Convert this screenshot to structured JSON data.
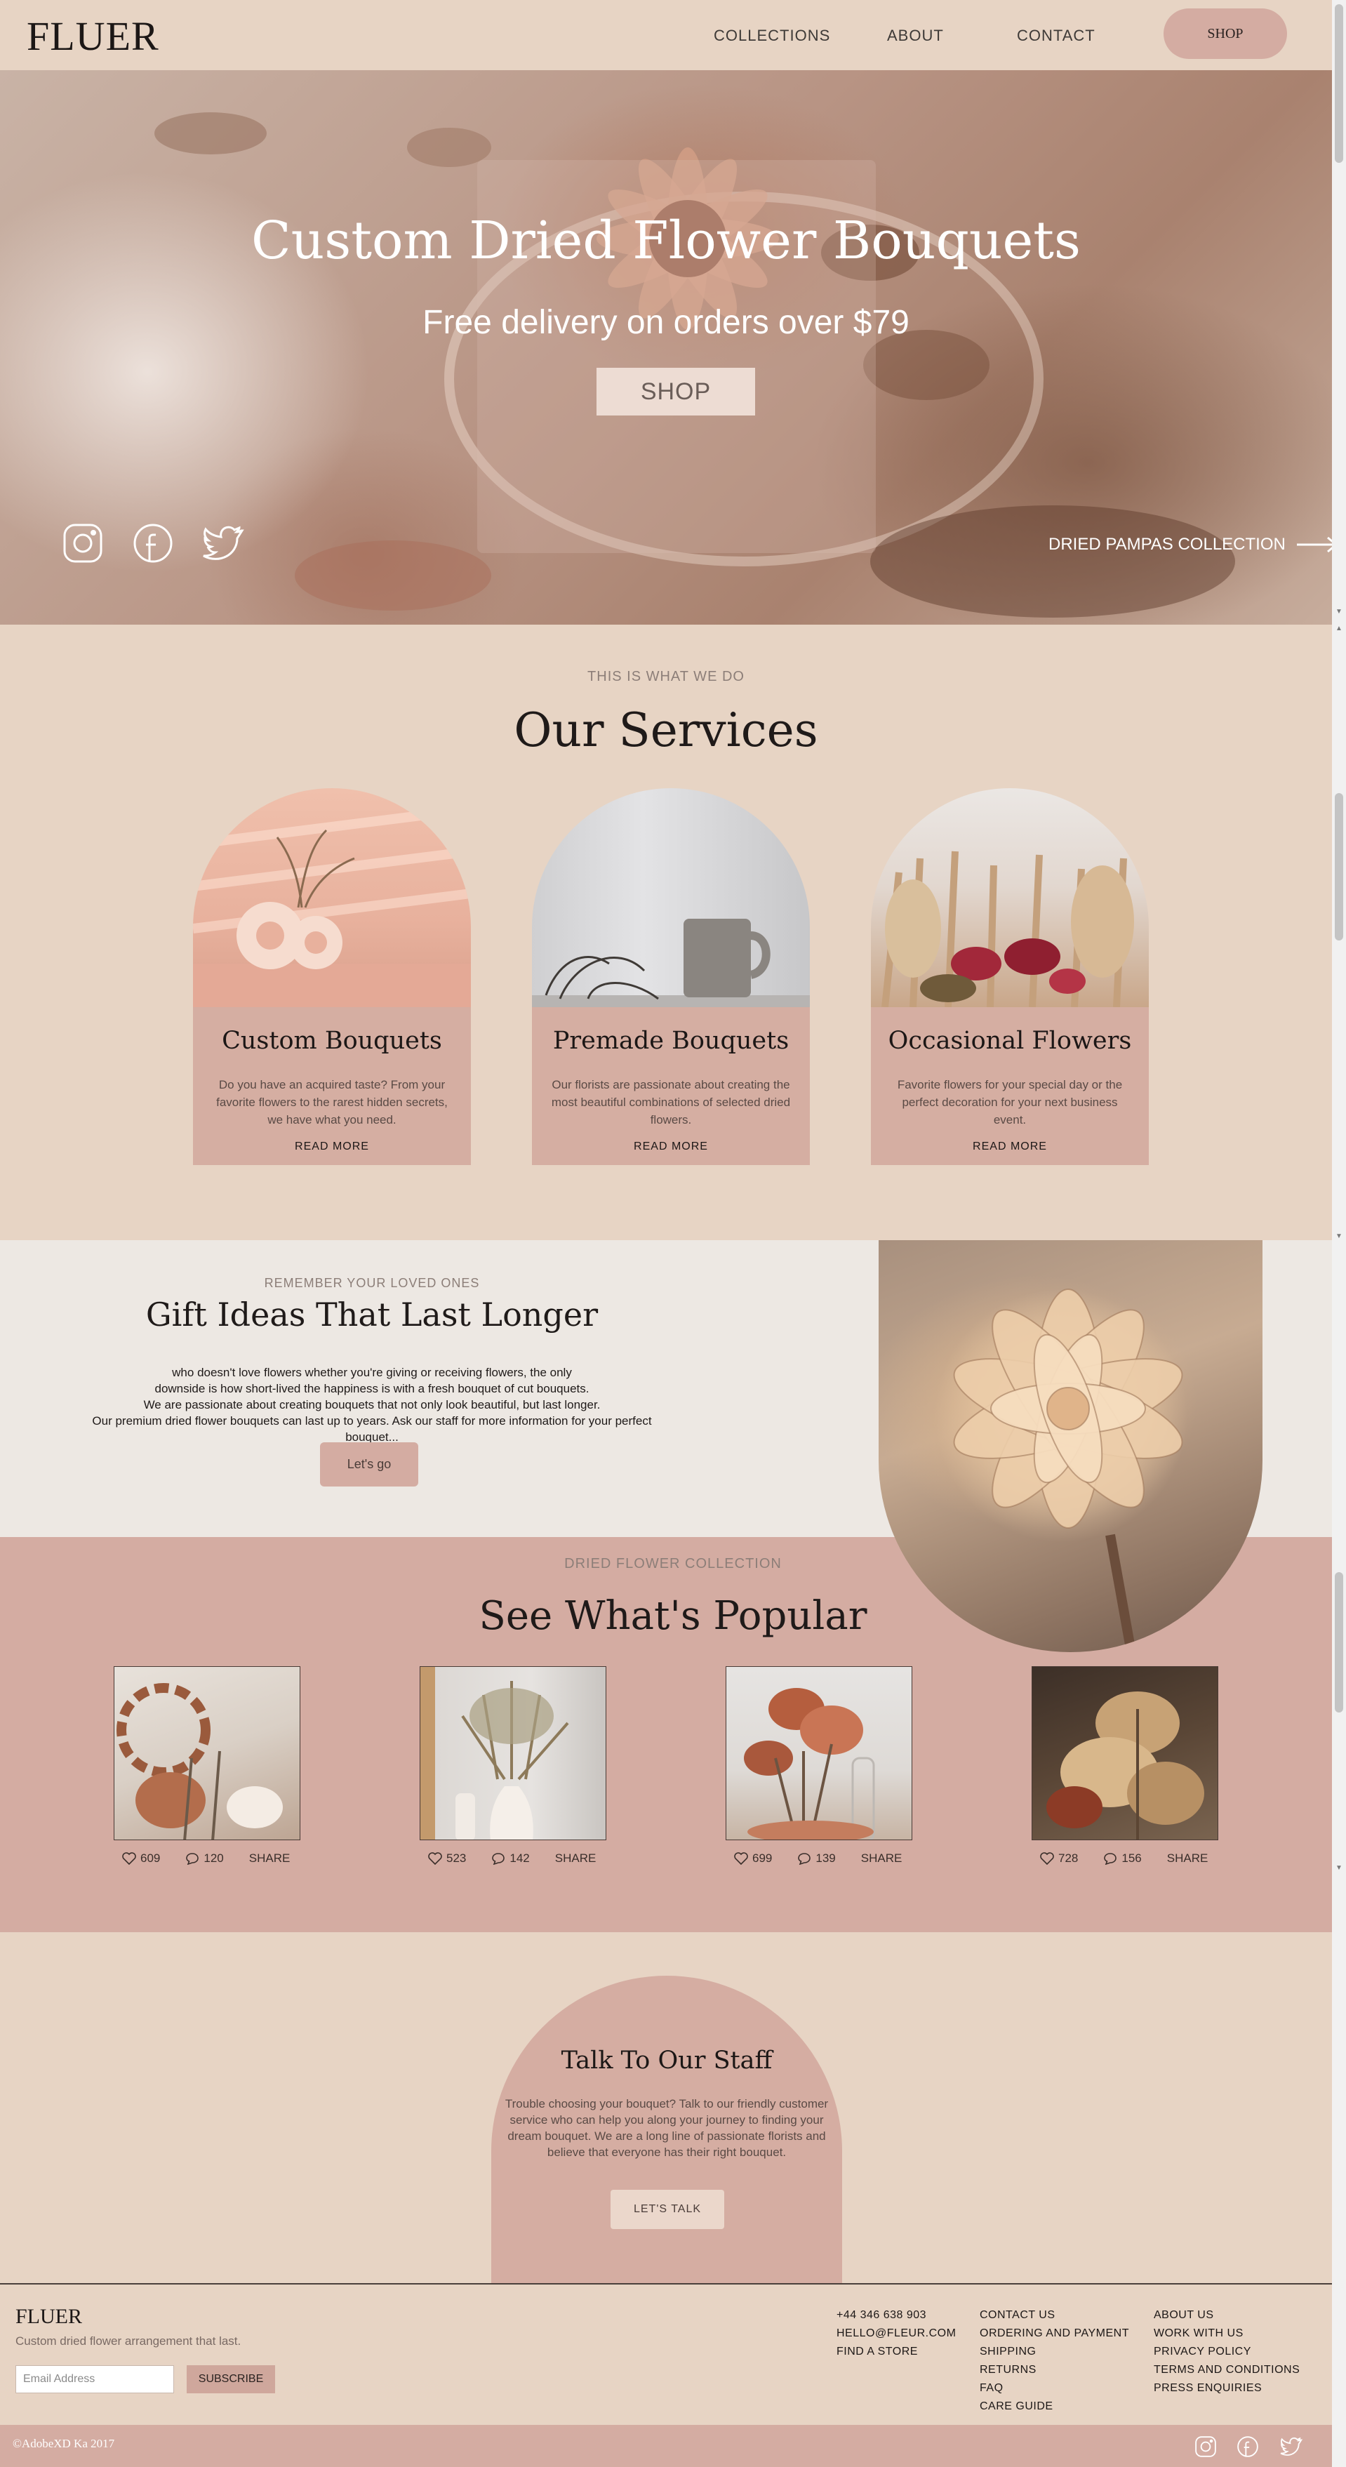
{
  "nav": {
    "logo": "FLUER",
    "links": [
      "COLLECTIONS",
      "ABOUT",
      "CONTACT"
    ],
    "shop": "SHOP"
  },
  "hero": {
    "title": "Custom Dried Flower Bouquets",
    "subtitle": "Free delivery on orders over $79",
    "shop": "SHOP",
    "pampas": "DRIED PAMPAS COLLECTION",
    "social_icons": [
      "instagram-icon",
      "facebook-icon",
      "twitter-icon"
    ]
  },
  "services": {
    "eyebrow": "THIS IS WHAT WE DO",
    "title": "Our Services",
    "cards": [
      {
        "title": "Custom Bouquets",
        "text": "Do you have an acquired taste? From your favorite flowers to the rarest hidden secrets, we have what you need.",
        "more": "READ MORE"
      },
      {
        "title": "Premade Bouquets",
        "text": "Our florists are passionate about creating the most beautiful combinations of selected dried flowers.",
        "more": "READ MORE"
      },
      {
        "title": "Occasional Flowers",
        "text": "Favorite flowers for your special day or the perfect decoration for your next business event.",
        "more": "READ MORE"
      }
    ]
  },
  "gift": {
    "eyebrow": "REMEMBER YOUR LOVED ONES",
    "title": "Gift Ideas That Last Longer",
    "lines": [
      "who doesn't love flowers whether you're giving or receiving flowers, the only",
      "downside is how short-lived the happiness is with a fresh bouquet of cut bouquets.",
      "We are passionate about creating bouquets that not only look beautiful, but last longer.",
      "Our premium dried flower bouquets can last up to years. Ask our staff for more information for your perfect bouquet..."
    ],
    "button": "Let's go"
  },
  "popular": {
    "eyebrow": "DRIED FLOWER COLLECTION",
    "title": "See What's Popular",
    "items": [
      {
        "likes": "609",
        "comments": "120",
        "share": "SHARE"
      },
      {
        "likes": "523",
        "comments": "142",
        "share": "SHARE"
      },
      {
        "likes": "699",
        "comments": "139",
        "share": "SHARE"
      },
      {
        "likes": "728",
        "comments": "156",
        "share": "SHARE"
      }
    ]
  },
  "talk": {
    "title": "Talk To Our Staff",
    "text": "Trouble choosing your bouquet? Talk to our friendly customer service who can help you along your journey to finding your dream bouquet. We are a long line of passionate florists and believe that everyone has their right bouquet.",
    "button": "LET'S TALK"
  },
  "footer": {
    "logo": "FLUER",
    "tagline": "Custom dried flower arrangement that last.",
    "email_placeholder": "Email Address",
    "subscribe": "SUBSCRIBE",
    "col1": [
      "+44 346 638 903",
      "HELLO@FLEUR.COM",
      "FIND A STORE"
    ],
    "col2": [
      "CONTACT US",
      "ORDERING AND PAYMENT",
      "SHIPPING",
      "RETURNS",
      "FAQ",
      "CARE GUIDE"
    ],
    "col3": [
      "ABOUT US",
      "WORK WITH US",
      "PRIVACY POLICY",
      "TERMS AND CONDITIONS",
      "PRESS ENQUIRIES"
    ],
    "copyright": "©AdobeXD Ka 2017"
  },
  "colors": {
    "background": "#e7d4c4",
    "accent": "#d4aca2",
    "gift_bg": "#ede8e3",
    "text_dark": "#1c1716"
  }
}
